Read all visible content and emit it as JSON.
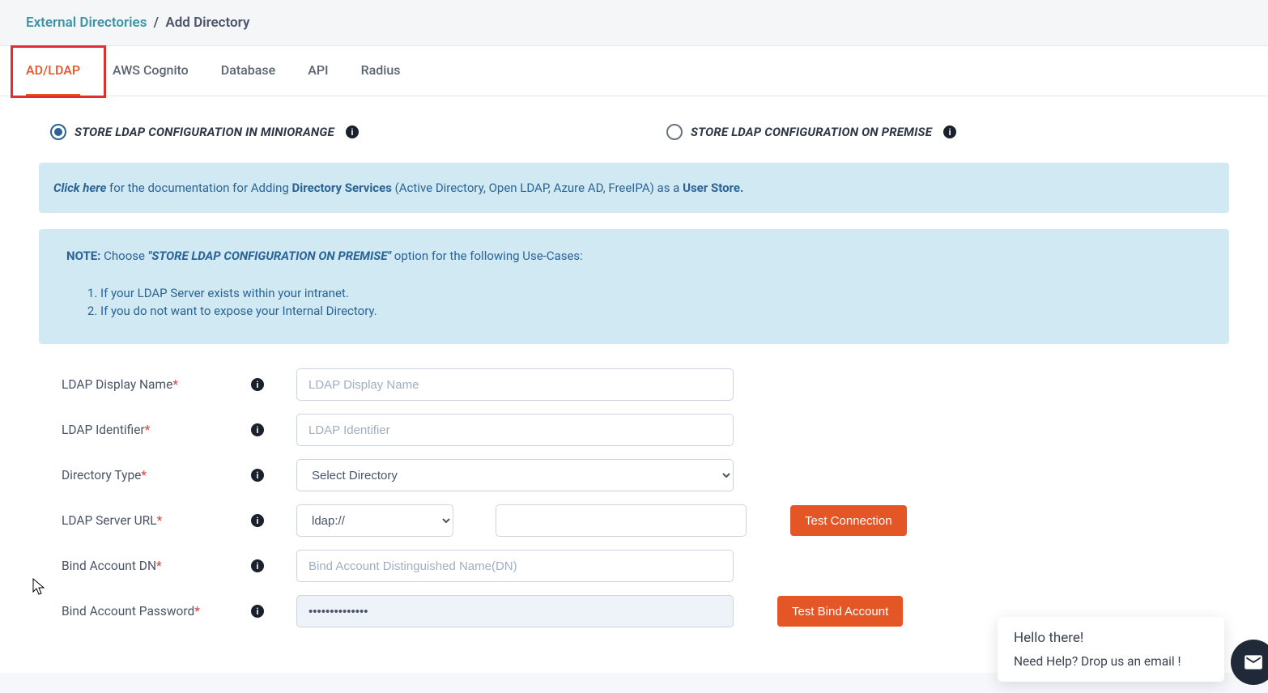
{
  "breadcrumb": {
    "parent": "External Directories",
    "separator": "/",
    "current": "Add Directory"
  },
  "tabs": [
    {
      "label": "AD/LDAP",
      "active": true
    },
    {
      "label": "AWS Cognito",
      "active": false
    },
    {
      "label": "Database",
      "active": false
    },
    {
      "label": "API",
      "active": false
    },
    {
      "label": "Radius",
      "active": false
    }
  ],
  "radios": {
    "opt1": "STORE LDAP CONFIGURATION IN MINIORANGE",
    "opt2": "STORE LDAP CONFIGURATION ON PREMISE"
  },
  "doc_alert": {
    "link": "Click here",
    "mid1": " for the documentation for Adding ",
    "bold1": "Directory Services",
    "mid2": " (Active Directory, Open LDAP, Azure AD, FreeIPA) as a ",
    "bold2": "User Store."
  },
  "note": {
    "label": "NOTE:",
    "text_pre": "  Choose ",
    "quote": "\"STORE LDAP CONFIGURATION ON PREMISE\"",
    "text_post": " option for the following Use-Cases:",
    "items": [
      "If your LDAP Server exists within your intranet.",
      "If you do not want to expose your Internal Directory."
    ]
  },
  "form": {
    "ldap_display_name": {
      "label": "LDAP Display Name",
      "placeholder": "LDAP Display Name"
    },
    "ldap_identifier": {
      "label": "LDAP Identifier",
      "placeholder": "LDAP Identifier"
    },
    "directory_type": {
      "label": "Directory Type",
      "placeholder": "Select Directory"
    },
    "ldap_server_url": {
      "label": "LDAP Server URL",
      "protocol": "ldap://",
      "host_value": ""
    },
    "bind_dn": {
      "label": "Bind Account DN",
      "placeholder": "Bind Account Distinguished Name(DN)"
    },
    "bind_pw": {
      "label": "Bind Account Password",
      "value": "••••••••••••••"
    }
  },
  "buttons": {
    "test_connection": "Test Connection",
    "test_bind": "Test Bind Account"
  },
  "chat": {
    "line1": "Hello there!",
    "line2": "Need Help? Drop us an email !"
  },
  "info_glyph": "i"
}
